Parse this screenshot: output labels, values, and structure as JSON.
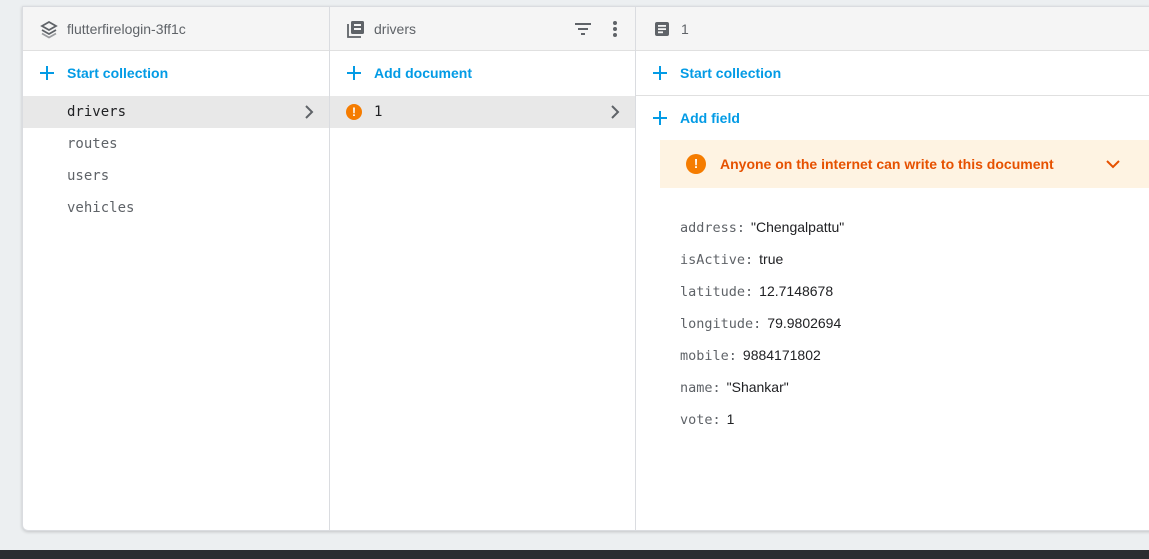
{
  "colors": {
    "accent": "#039be5",
    "warning": "#f57c00",
    "warning_text": "#e65100",
    "warning_bg": "#fef3e2"
  },
  "root": {
    "title": "flutterfirelogin-3ff1c",
    "icon": "firestore-stack-icon",
    "action_label": "Start collection",
    "collections": [
      "drivers",
      "routes",
      "users",
      "vehicles"
    ],
    "selected": "drivers"
  },
  "collection": {
    "title": "drivers",
    "icon": "collection-icon",
    "action_label": "Add document",
    "documents": [
      {
        "id": "1",
        "warning_icon": "!"
      }
    ]
  },
  "document": {
    "title": "1",
    "icon": "document-icon",
    "start_collection_label": "Start collection",
    "add_field_label": "Add field",
    "warning": {
      "icon": "!",
      "text": "Anyone on the internet can write to this document"
    },
    "fields": [
      {
        "key": "address:",
        "value": "\"Chengalpattu\""
      },
      {
        "key": "isActive:",
        "value": "true"
      },
      {
        "key": "latitude:",
        "value": "12.7148678"
      },
      {
        "key": "longitude:",
        "value": "79.9802694"
      },
      {
        "key": "mobile:",
        "value": "9884171802"
      },
      {
        "key": "name:",
        "value": "\"Shankar\""
      },
      {
        "key": "vote:",
        "value": "1"
      }
    ]
  }
}
